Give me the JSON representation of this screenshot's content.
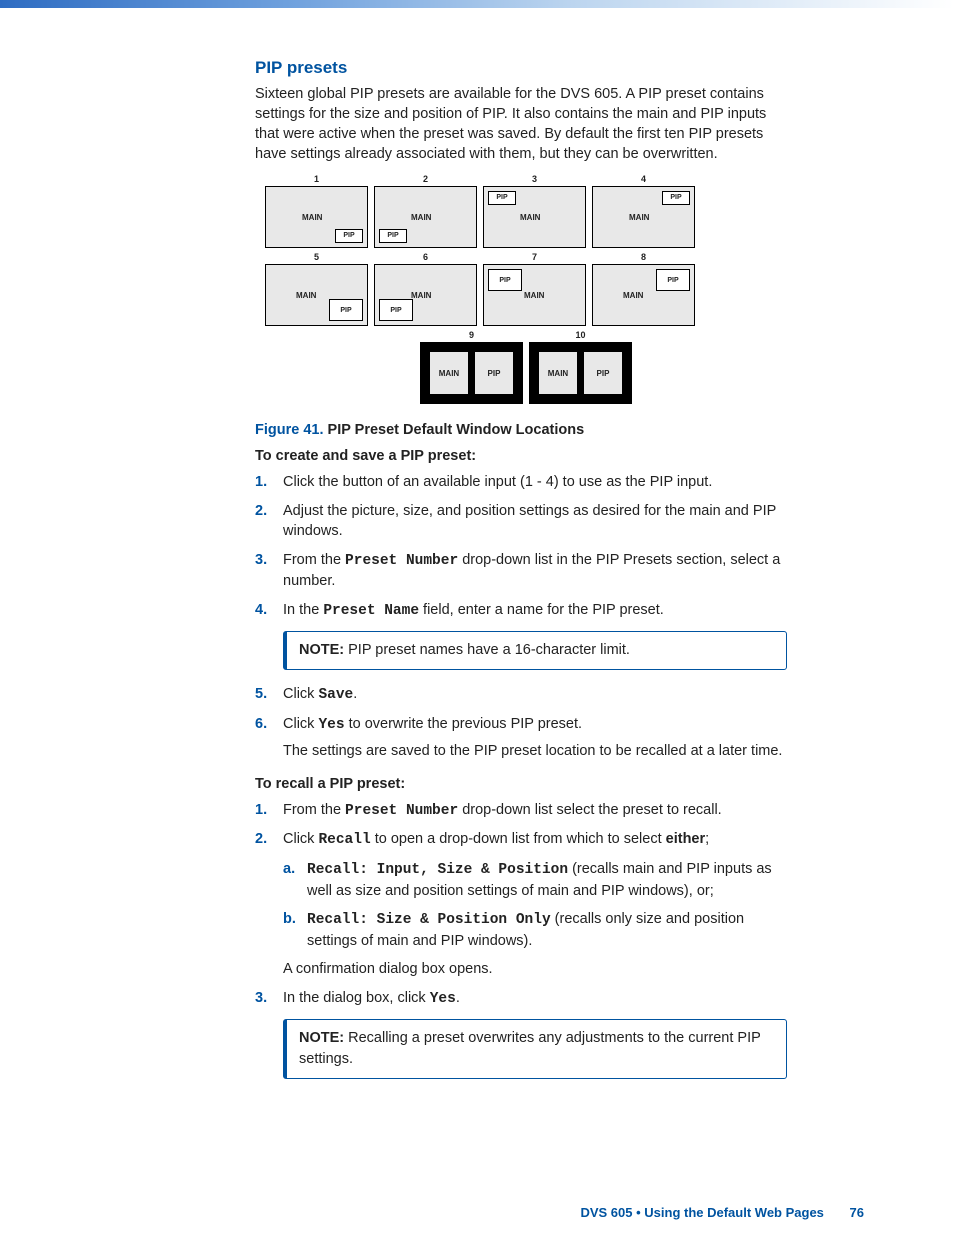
{
  "section": {
    "title": "PIP presets",
    "intro": "Sixteen global PIP presets are available for the DVS 605. A PIP preset contains settings for the size and position of PIP. It also contains the main and PIP inputs that were active when the preset was saved. By default the first ten PIP presets have settings already associated with them, but they can be overwritten."
  },
  "figure": {
    "mainLabel": "MAIN",
    "pipLabel": "PIP",
    "presets": [
      "1",
      "2",
      "3",
      "4",
      "5",
      "6",
      "7",
      "8",
      "9",
      "10"
    ],
    "captionNum": "Figure 41.",
    "captionTitle": "PIP Preset Default Window Locations"
  },
  "create": {
    "heading": "To create and save a PIP preset:",
    "step1": "Click the button of an available input (1 - 4) to use as the PIP input.",
    "step2": "Adjust the picture, size, and position settings as desired for the main and PIP windows.",
    "step3a": "From the ",
    "step3mono": "Preset Number",
    "step3b": " drop-down list in the PIP Presets section, select a number.",
    "step4a": "In the ",
    "step4mono": "Preset Name",
    "step4b": " field, enter a name for the PIP preset.",
    "note1Label": "NOTE:",
    "note1Text": "  PIP preset names have a 16-character limit.",
    "step5a": "Click ",
    "step5mono": "Save",
    "step5b": ".",
    "step6a": "Click ",
    "step6mono": "Yes",
    "step6b": " to overwrite the previous PIP preset.",
    "step6cont": "The settings are saved to the PIP preset location to be recalled at a later time."
  },
  "recall": {
    "heading": "To recall a PIP preset:",
    "step1a": "From the ",
    "step1mono": "Preset Number",
    "step1b": " drop-down list select the preset to recall.",
    "step2a": "Click ",
    "step2mono": "Recall",
    "step2b": " to open a drop-down list from which to select ",
    "step2either": "either",
    "step2semi": ";",
    "subAMarker": "a.",
    "subAMono": "Recall: Input, Size & Position",
    "subAText": " (recalls main and PIP inputs as well as size and position settings of main and PIP windows), or;",
    "subBMarker": "b.",
    "subBMono": "Recall: Size & Position Only",
    "subBText": " (recalls only size and position settings of main and PIP windows).",
    "step2cont": "A confirmation dialog box opens.",
    "step3a": "In the dialog box, click ",
    "step3mono": "Yes",
    "step3b": ".",
    "note2Label": "NOTE:",
    "note2Text": "  Recalling a preset overwrites any adjustments to the current PIP settings."
  },
  "footer": {
    "title": "DVS 605 • Using the Default Web Pages",
    "page": "76"
  }
}
